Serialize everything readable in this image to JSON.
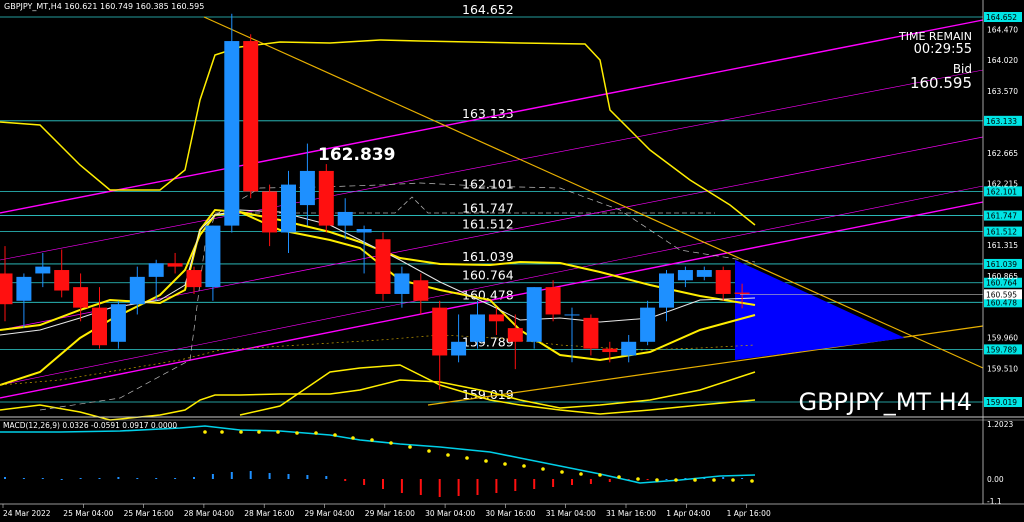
{
  "header": {
    "symbol_line": "GBPJPY_MT,H4  160.621 160.749 160.385 160.595"
  },
  "info": {
    "time_remain_label": "TIME REMAIN",
    "time_remain_value": "00:29:55",
    "bid_label": "Bid",
    "bid_value": "160.595",
    "watermark": "GBPJPY_MT H4",
    "high_label": "162.839"
  },
  "price_axis": {
    "ticks": [
      "164.470",
      "164.020",
      "163.570",
      "162.665",
      "162.215",
      "161.315",
      "160.865",
      "159.960",
      "159.510"
    ]
  },
  "levels": [
    {
      "price": "164.652",
      "label": "164.652"
    },
    {
      "price": "163.133",
      "label": "163.133"
    },
    {
      "price": "162.101",
      "label": "162.101"
    },
    {
      "price": "161.747",
      "label": "161.747"
    },
    {
      "price": "161.512",
      "label": "161.512"
    },
    {
      "price": "161.039",
      "label": "161.039"
    },
    {
      "price": "160.764",
      "label": "160.764"
    },
    {
      "price": "160.478",
      "label": "160.478"
    },
    {
      "price": "159.789",
      "label": "159.789"
    },
    {
      "price": "159.019",
      "label": "159.019"
    }
  ],
  "current_price": "160.595",
  "macd": {
    "label": "MACD(12,26,9) 0.0326 -0.0591 0.0917 0.0000",
    "ticks": [
      "1.2023",
      "0.00",
      "-1.1"
    ]
  },
  "time_axis": [
    "24 Mar 2022",
    "25 Mar 04:00",
    "25 Mar 16:00",
    "28 Mar 04:00",
    "28 Mar 16:00",
    "29 Mar 04:00",
    "29 Mar 16:00",
    "30 Mar 04:00",
    "30 Mar 16:00",
    "31 Mar 04:00",
    "31 Mar 16:00",
    "1 Apr 04:00",
    "1 Apr 16:00"
  ],
  "colors": {
    "bull": "#1e90ff",
    "bear": "#ff1010",
    "level_line": "#2fd0d0",
    "level_box": "#00e5e5",
    "band": "#ffee00",
    "trend_magenta": "#ff00ff",
    "trend_orange": "#e8b000",
    "triangle": "#0000ff"
  },
  "candles": [
    {
      "o": 160.9,
      "h": 161.3,
      "l": 160.2,
      "c": 160.45
    },
    {
      "o": 160.5,
      "h": 160.9,
      "l": 160.1,
      "c": 160.85
    },
    {
      "o": 160.9,
      "h": 161.2,
      "l": 160.7,
      "c": 161.0
    },
    {
      "o": 160.95,
      "h": 161.25,
      "l": 160.55,
      "c": 160.65
    },
    {
      "o": 160.7,
      "h": 160.9,
      "l": 160.2,
      "c": 160.4
    },
    {
      "o": 160.4,
      "h": 160.7,
      "l": 159.8,
      "c": 159.85
    },
    {
      "o": 159.9,
      "h": 160.5,
      "l": 159.8,
      "c": 160.45
    },
    {
      "o": 160.45,
      "h": 161.0,
      "l": 160.3,
      "c": 160.85
    },
    {
      "o": 160.85,
      "h": 161.1,
      "l": 160.5,
      "c": 161.05
    },
    {
      "o": 161.05,
      "h": 161.2,
      "l": 160.9,
      "c": 161.0
    },
    {
      "o": 160.95,
      "h": 161.0,
      "l": 160.6,
      "c": 160.7
    },
    {
      "o": 160.7,
      "h": 161.6,
      "l": 160.5,
      "c": 161.6
    },
    {
      "o": 161.6,
      "h": 164.7,
      "l": 161.5,
      "c": 164.3
    },
    {
      "o": 164.3,
      "h": 164.4,
      "l": 162.0,
      "c": 162.1
    },
    {
      "o": 162.1,
      "h": 162.2,
      "l": 161.3,
      "c": 161.5
    },
    {
      "o": 161.5,
      "h": 162.4,
      "l": 161.2,
      "c": 162.2
    },
    {
      "o": 161.9,
      "h": 162.8,
      "l": 161.6,
      "c": 162.4
    },
    {
      "o": 162.4,
      "h": 162.5,
      "l": 161.5,
      "c": 161.6
    },
    {
      "o": 161.6,
      "h": 162.0,
      "l": 161.4,
      "c": 161.8
    },
    {
      "o": 161.5,
      "h": 161.6,
      "l": 160.9,
      "c": 161.55
    },
    {
      "o": 161.4,
      "h": 161.5,
      "l": 160.5,
      "c": 160.6
    },
    {
      "o": 160.6,
      "h": 161.0,
      "l": 160.4,
      "c": 160.9
    },
    {
      "o": 160.8,
      "h": 160.9,
      "l": 160.3,
      "c": 160.5
    },
    {
      "o": 160.4,
      "h": 160.5,
      "l": 159.2,
      "c": 159.7
    },
    {
      "o": 159.7,
      "h": 160.3,
      "l": 159.6,
      "c": 159.9
    },
    {
      "o": 159.9,
      "h": 160.5,
      "l": 159.8,
      "c": 160.3
    },
    {
      "o": 160.3,
      "h": 160.4,
      "l": 160.0,
      "c": 160.2
    },
    {
      "o": 160.1,
      "h": 160.3,
      "l": 159.5,
      "c": 159.9
    },
    {
      "o": 159.9,
      "h": 160.7,
      "l": 159.8,
      "c": 160.7
    },
    {
      "o": 160.7,
      "h": 160.8,
      "l": 160.2,
      "c": 160.3
    },
    {
      "o": 160.3,
      "h": 160.4,
      "l": 159.6,
      "c": 160.3
    },
    {
      "o": 160.25,
      "h": 160.3,
      "l": 159.7,
      "c": 159.8
    },
    {
      "o": 159.8,
      "h": 159.9,
      "l": 159.6,
      "c": 159.75
    },
    {
      "o": 159.7,
      "h": 160.0,
      "l": 159.6,
      "c": 159.9
    },
    {
      "o": 159.9,
      "h": 160.5,
      "l": 159.85,
      "c": 160.4
    },
    {
      "o": 160.4,
      "h": 160.95,
      "l": 160.2,
      "c": 160.9
    },
    {
      "o": 160.8,
      "h": 161.0,
      "l": 160.7,
      "c": 160.95
    },
    {
      "o": 160.85,
      "h": 161.0,
      "l": 160.8,
      "c": 160.95
    },
    {
      "o": 160.95,
      "h": 161.0,
      "l": 160.5,
      "c": 160.6
    },
    {
      "o": 160.62,
      "h": 160.75,
      "l": 160.39,
      "c": 160.6
    }
  ]
}
